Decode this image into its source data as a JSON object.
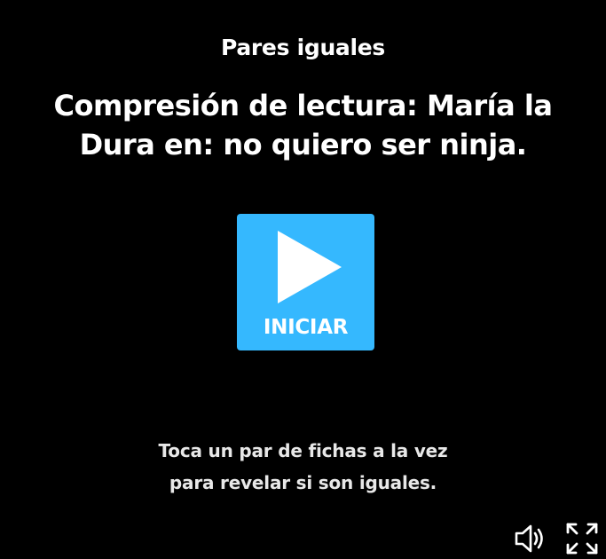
{
  "activity": {
    "type_label": "Pares iguales",
    "title": "Compresión de lectura: María la Dura en: no quiero ser ninja."
  },
  "start_button": {
    "label": "INICIAR",
    "icon": "play-icon",
    "color": "#35b8fe"
  },
  "instructions": {
    "line1": "Toca un par de fichas a la vez",
    "line2": "para revelar si son iguales."
  },
  "controls": {
    "sound_icon": "speaker-icon",
    "fullscreen_icon": "fullscreen-icon"
  },
  "colors": {
    "background": "#000000",
    "text": "#ffffff"
  }
}
